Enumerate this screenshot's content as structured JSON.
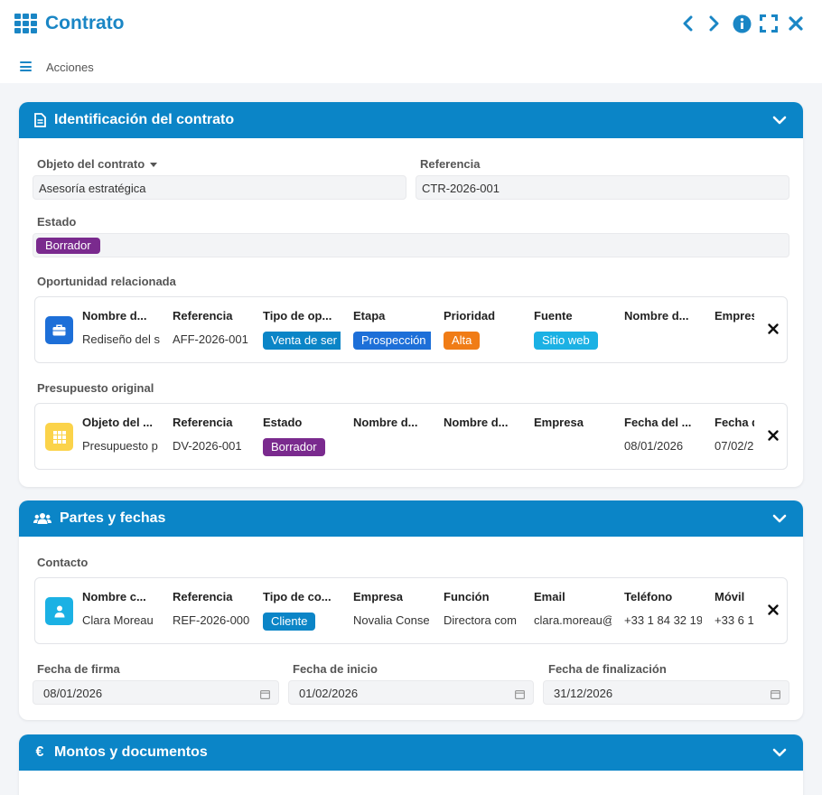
{
  "window": {
    "title": "Contrato"
  },
  "toolbar": {
    "acciones_label": "Acciones"
  },
  "colors": {
    "accent": "#0b85c7",
    "purple": "#7a2a8e",
    "orange": "#f07c16",
    "cyan": "#1bb1e4"
  },
  "sections": {
    "identificacion": {
      "title": "Identificación del contrato",
      "objeto_label": "Objeto del contrato",
      "objeto_value": "Asesoría estratégica",
      "referencia_label": "Referencia",
      "referencia_value": "CTR-2026-001",
      "estado_label": "Estado",
      "estado_value": "Borrador",
      "oportunidad_label": "Oportunidad relacionada",
      "oportunidad": {
        "icon": "briefcase-icon",
        "columns": [
          {
            "header": "Nombre d...",
            "value": "Rediseño del s"
          },
          {
            "header": "Referencia",
            "value": "AFF-2026-001"
          },
          {
            "header": "Tipo de op...",
            "value": "Venta de ser",
            "badge": "blue"
          },
          {
            "header": "Etapa",
            "value": "Prospección",
            "badge": "blue2"
          },
          {
            "header": "Prioridad",
            "value": "Alta",
            "badge": "orange"
          },
          {
            "header": "Fuente",
            "value": "Sitio web",
            "badge": "cyan"
          },
          {
            "header": "Nombre d...",
            "value": ""
          },
          {
            "header": "Empres",
            "value": ""
          }
        ]
      },
      "presupuesto_label": "Presupuesto original",
      "presupuesto": {
        "icon": "grid-icon",
        "columns": [
          {
            "header": "Objeto del ...",
            "value": "Presupuesto p"
          },
          {
            "header": "Referencia",
            "value": "DV-2026-001"
          },
          {
            "header": "Estado",
            "value": "Borrador",
            "badge": "purple"
          },
          {
            "header": "Nombre d...",
            "value": ""
          },
          {
            "header": "Nombre d...",
            "value": ""
          },
          {
            "header": "Empresa",
            "value": ""
          },
          {
            "header": "Fecha del ...",
            "value": "08/01/2026"
          },
          {
            "header": "Fecha d",
            "value": "07/02/2"
          }
        ]
      }
    },
    "partes": {
      "title": "Partes y fechas",
      "contacto_label": "Contacto",
      "contacto": {
        "icon": "user-icon",
        "columns": [
          {
            "header": "Nombre c...",
            "value": "Clara Moreau"
          },
          {
            "header": "Referencia",
            "value": "REF-2026-000"
          },
          {
            "header": "Tipo de co...",
            "value": "Cliente",
            "badge": "blue"
          },
          {
            "header": "Empresa",
            "value": "Novalia Conse"
          },
          {
            "header": "Función",
            "value": "Directora com"
          },
          {
            "header": "Email",
            "value": "clara.moreau@"
          },
          {
            "header": "Teléfono",
            "value": "+33 1 84 32 19"
          },
          {
            "header": "Móvil",
            "value": "+33 6 1"
          }
        ]
      },
      "fecha_firma_label": "Fecha de firma",
      "fecha_firma_value": "08/01/2026",
      "fecha_inicio_label": "Fecha de inicio",
      "fecha_inicio_value": "01/02/2026",
      "fecha_fin_label": "Fecha de finalización",
      "fecha_fin_value": "31/12/2026"
    },
    "montos": {
      "title": "Montos y documentos",
      "icon_glyph": "€"
    }
  }
}
